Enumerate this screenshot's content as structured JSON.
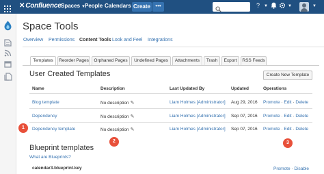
{
  "topbar": {
    "brand": "Confluence",
    "nav": {
      "spaces": "Spaces",
      "people": "People",
      "calendars": "Calendars"
    },
    "create_label": "Create",
    "more_label": "•••",
    "colors": {
      "bar": "#205081",
      "button": "#3572b0"
    }
  },
  "page": {
    "title": "Space Tools"
  },
  "subnav": {
    "items": [
      "Overview",
      "Permissions",
      "Content Tools",
      "Look and Feel",
      "Integrations"
    ],
    "active": "Content Tools"
  },
  "tabs": {
    "items": [
      "Templates",
      "Reorder Pages",
      "Orphaned Pages",
      "Undefined Pages",
      "Attachments",
      "Trash",
      "Export",
      "RSS Feeds"
    ],
    "active": "Templates"
  },
  "user_templates": {
    "title": "User Created Templates",
    "create_button": "Create New Template",
    "headers": {
      "name": "Name",
      "description": "Description",
      "updated_by": "Last Updated By",
      "updated": "Updated",
      "operations": "Operations"
    },
    "rows": [
      {
        "name": "Blog template",
        "description": "No description",
        "updated_by": "Liam Holmes [Administrator]",
        "updated": "Aug 29, 2016"
      },
      {
        "name": "Dependency",
        "description": "No description",
        "updated_by": "Liam Holmes [Administrator]",
        "updated": "Sep 07, 2016"
      },
      {
        "name": "Dependency template",
        "description": "No description",
        "updated_by": "Liam Holmes [Administrator]",
        "updated": "Sep 07, 2016"
      }
    ],
    "operations": {
      "promote": "Promote",
      "edit": "Edit",
      "delete": "Delete",
      "sep": "·"
    }
  },
  "callouts": [
    "1",
    "2",
    "3"
  ],
  "blueprints": {
    "title": "Blueprint templates",
    "help_link": "What are Blueprints?",
    "rows": [
      {
        "key": "calendar3.blueprint.key"
      }
    ],
    "operations": {
      "promote": "Promote",
      "disable": "Disable",
      "sep": "·"
    }
  }
}
